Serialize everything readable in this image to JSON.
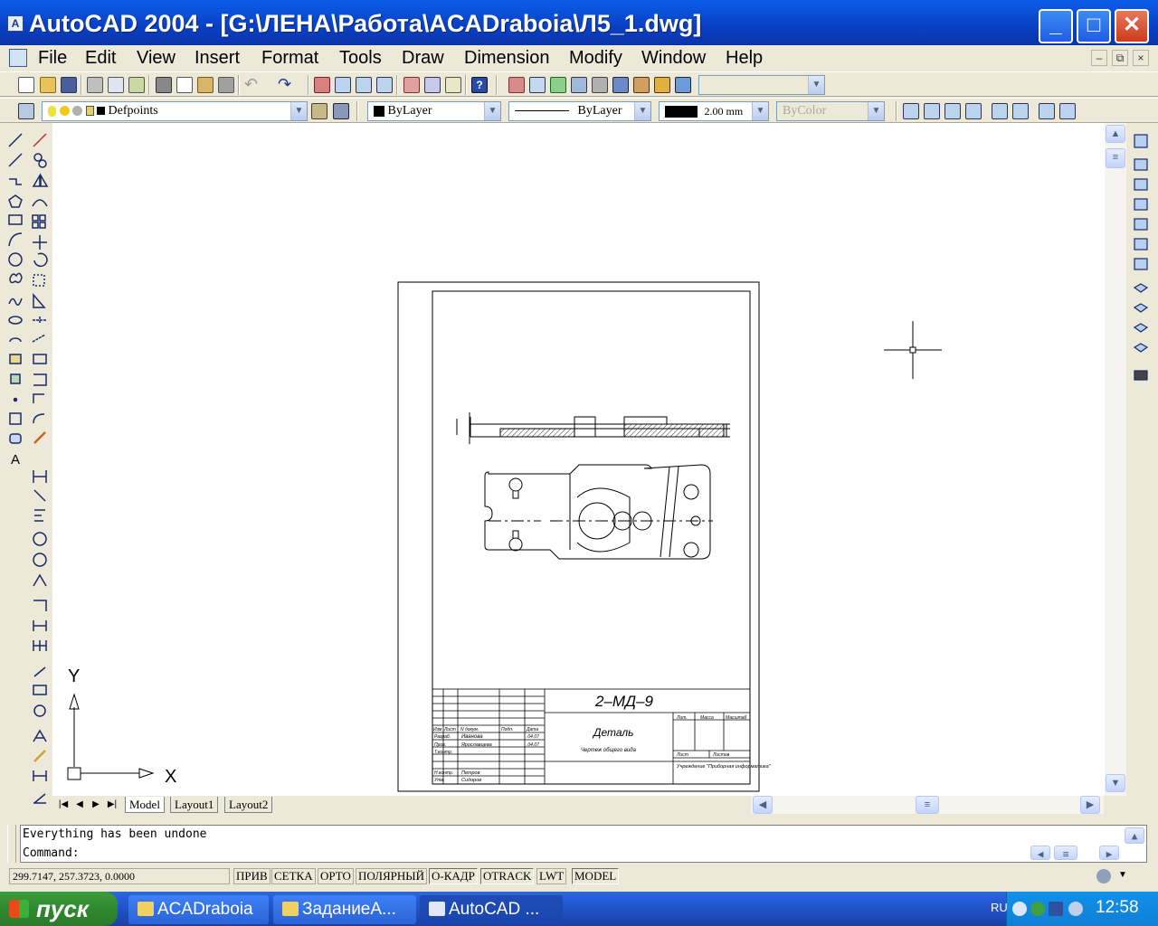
{
  "window": {
    "title": "AutoCAD 2004 - [G:\\ЛЕНА\\Работа\\ACADraboia\\Л5_1.dwg]",
    "minimize": "_",
    "maximize": "□",
    "close": "✕"
  },
  "menu": [
    "File",
    "Edit",
    "View",
    "Insert",
    "Format",
    "Tools",
    "Draw",
    "Dimension",
    "Modify",
    "Window",
    "Help"
  ],
  "mdi": {
    "minimize": "–",
    "restore": "⧉",
    "close": "×"
  },
  "properties": {
    "layer": "Defpoints",
    "color": "ByLayer",
    "linetype": "ByLayer",
    "lineweight": "2.00 mm",
    "plotstyle": "ByColor"
  },
  "drawing": {
    "ucs_y": "Y",
    "ucs_x": "X",
    "designation": "2–МД–9",
    "part_name": "Деталь",
    "part_subtitle": "Чертеж общего вида",
    "org": "Учреждение \"Приборная информатика\"",
    "tb_headers": [
      "Изм",
      "Лист",
      "N докум.",
      "Подп.",
      "Дата"
    ],
    "tb_roles": [
      "Разраб.",
      "Пров.",
      "Т.контр.",
      "Н.контр.",
      "Утв."
    ],
    "tb_names": [
      "Иванова",
      "Ярославцева",
      "",
      "Петров",
      "Сидоров"
    ],
    "tb_dates": [
      ".04.07",
      ".04.07"
    ],
    "tb_right_headers": [
      "Лит.",
      "Масса",
      "Масштаб"
    ],
    "tb_sheet": "Лист",
    "tb_sheets": "Листов"
  },
  "tabs": [
    "Model",
    "Layout1",
    "Layout2"
  ],
  "command": {
    "history": "Everything has been undone",
    "prompt": "Command:"
  },
  "status": {
    "coords": "299.7147, 257.3723, 0.0000",
    "buttons": [
      {
        "label": "ПРИВ",
        "on": false
      },
      {
        "label": "СЕТКА",
        "on": false
      },
      {
        "label": "ОРТО",
        "on": false
      },
      {
        "label": "ПОЛЯРНЫЙ",
        "on": false
      },
      {
        "label": "О-КАДР",
        "on": true
      },
      {
        "label": "OTRACK",
        "on": true
      },
      {
        "label": "LWT",
        "on": false
      },
      {
        "label": "MODEL",
        "on": true
      }
    ]
  },
  "taskbar": {
    "start": "пуск",
    "tasks": [
      "ACADraboia",
      "ЗаданиеA...",
      "AutoCAD ..."
    ],
    "lang": "RU",
    "clock": "12:58"
  },
  "colors": {
    "xp_blue": "#0a3fc4",
    "face": "#ece9d8",
    "start_green": "#2f8a2f"
  }
}
